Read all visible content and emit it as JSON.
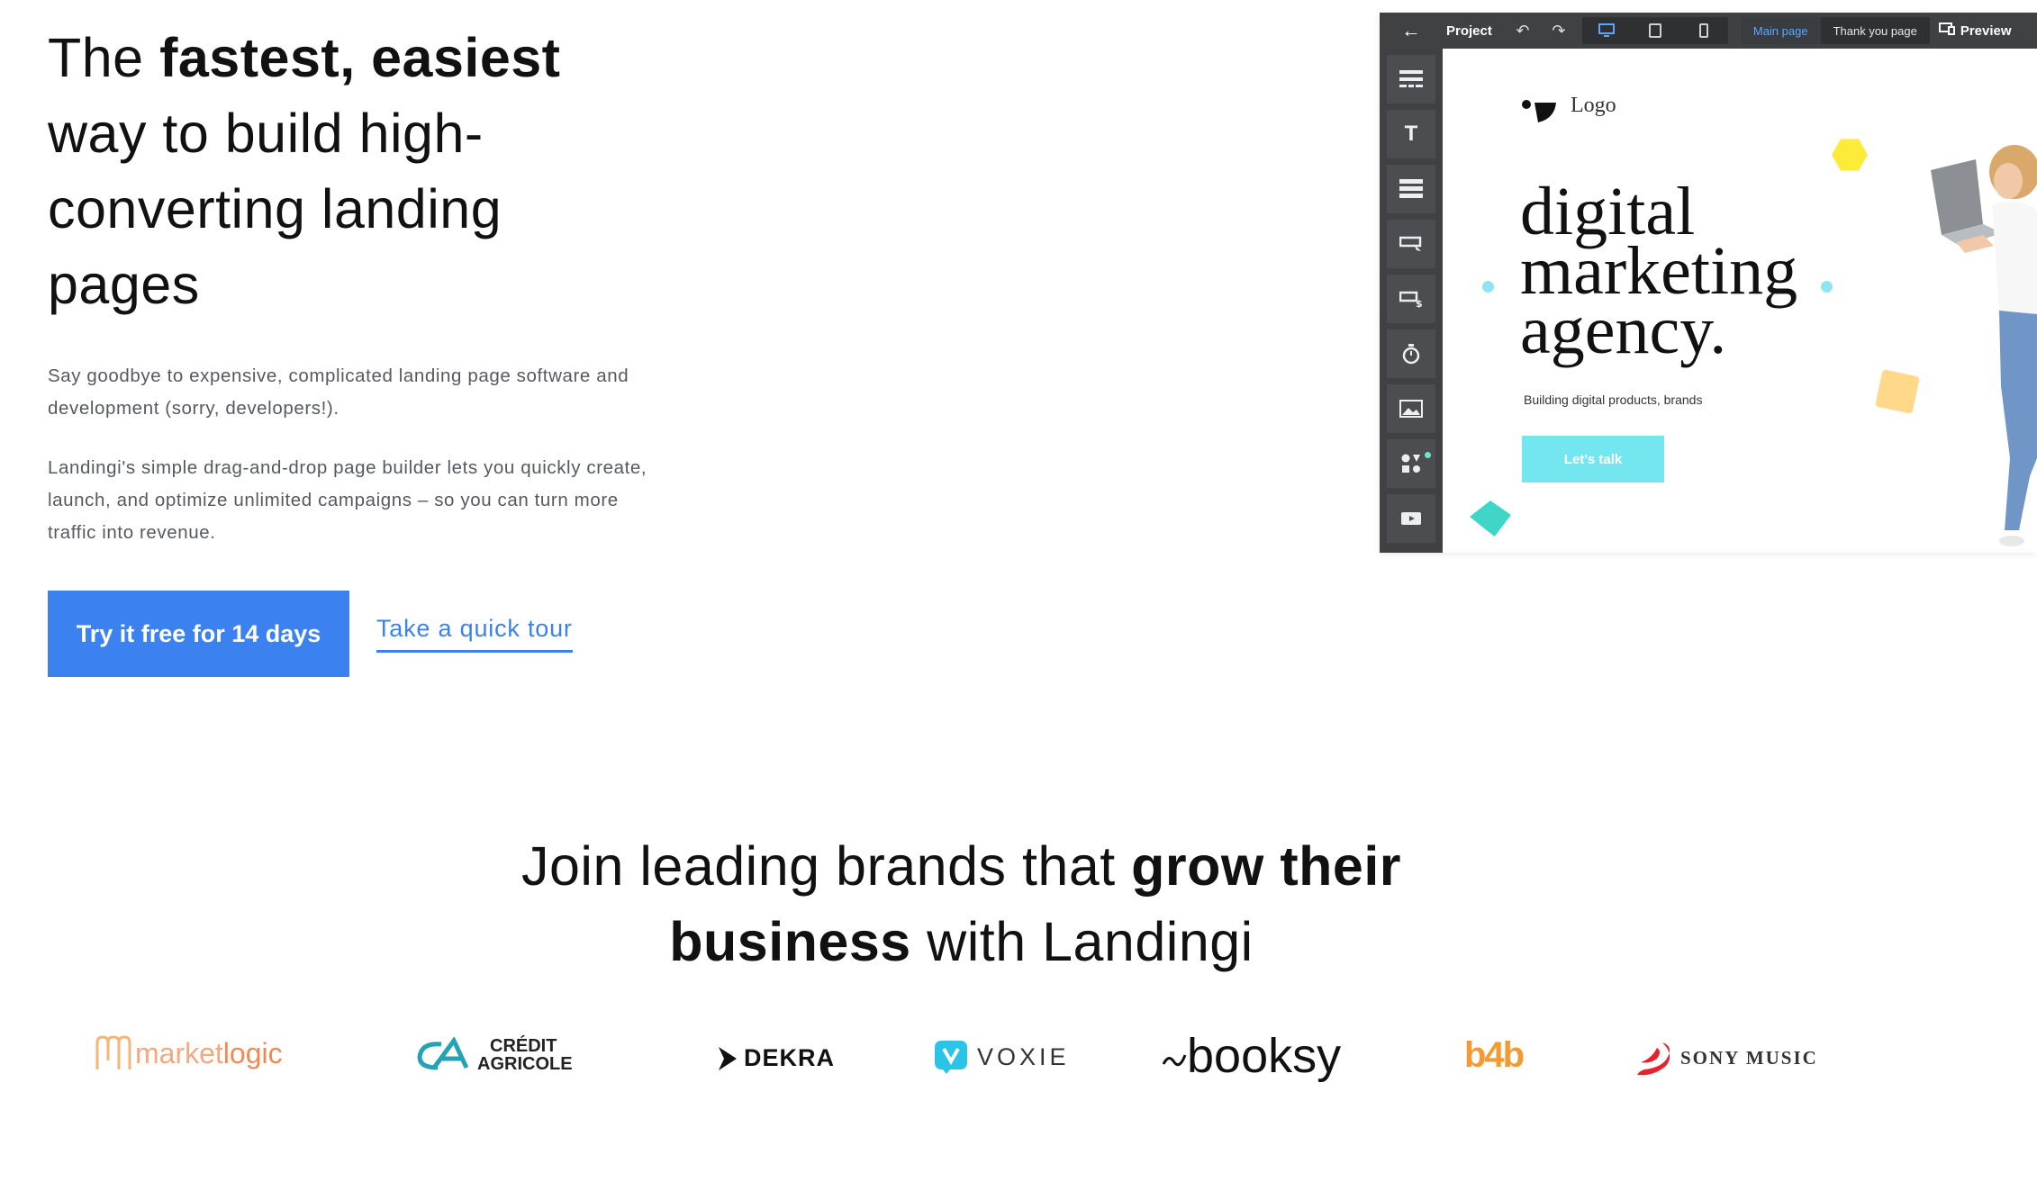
{
  "hero": {
    "title_pre": "The ",
    "title_bold": "fastest, easiest",
    "title_post": " way to build high-converting landing pages",
    "paragraph1": "Say goodbye to expensive, complicated landing page software and development (sorry, developers!).",
    "paragraph2": "Landingi's simple drag-and-drop page builder lets you quickly create, launch, and optimize unlimited campaigns – so you can turn more traffic into revenue.",
    "cta_primary": "Try it free for 14 days",
    "cta_secondary": "Take a quick tour"
  },
  "editor": {
    "back_icon": "arrow-left-icon",
    "project_label": "Project",
    "pages": [
      "Main page",
      "Thank you page"
    ],
    "active_page": "Main page",
    "preview_label": "Preview",
    "canvas": {
      "logo_text": "Logo",
      "heading_line1": "digital",
      "heading_line2": "marketing",
      "heading_line3": "agency.",
      "subheading": "Building digital products, brands",
      "button": "Let's talk"
    },
    "accent_color": "#74e6ef"
  },
  "brands": {
    "title_pre": "Join leading brands that ",
    "title_bold1": "grow their",
    "title_bold2": "business",
    "title_post": " with Landingi",
    "logos": {
      "marketlogic_a": "market",
      "marketlogic_b": "logic",
      "credit_agricole_1": "CRÉDIT",
      "credit_agricole_2": "AGRICOLE",
      "dekra": "DEKRA",
      "voxie": "VOXIE",
      "booksy": "booksy",
      "b4b": "b4b",
      "sony_music": "SONY MUSIC"
    }
  },
  "colors": {
    "primary_blue": "#3b82f0",
    "editor_dark": "#3f4143",
    "editor_highlight": "#5aa7ff"
  }
}
